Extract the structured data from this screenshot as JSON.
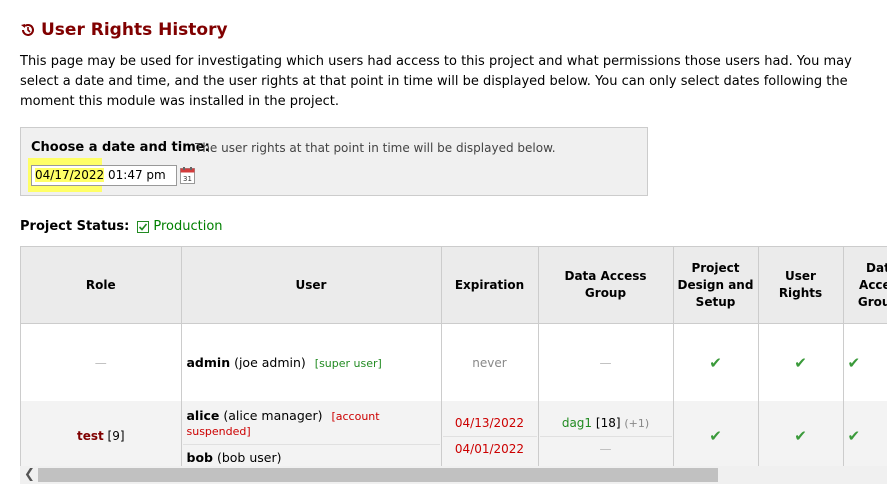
{
  "page": {
    "title": "User Rights History",
    "intro": "This page may be used for investigating which users had access to this project and what permissions those users had. You may select a date and time, and the user rights at that point in time will be displayed below. You can only select dates following the moment this module was installed in the project."
  },
  "picker": {
    "label": "Choose a date and time:",
    "hint": "The user rights at that point in time will be displayed below.",
    "date": "04/17/2022",
    "time": "01:47 pm"
  },
  "status": {
    "label": "Project Status:",
    "value": "Production"
  },
  "table": {
    "headers": {
      "role": "Role",
      "user": "User",
      "expiration": "Expiration",
      "dag": "Data Access Group",
      "design": "Project Design and Setup",
      "rights": "User Rights",
      "next": "Data Access Groups"
    },
    "row1": {
      "role": "—",
      "user_name": "admin",
      "user_full": "(joe admin)",
      "user_tag": "[super user]",
      "expiration": "never",
      "dag": "—"
    },
    "row2": {
      "role_name": "test",
      "role_count": "[9]",
      "user1_name": "alice",
      "user1_full": "(alice manager)",
      "user1_tag": "[account suspended]",
      "user1_exp": "04/13/2022",
      "user2_name": "bob",
      "user2_full": "(bob user)",
      "user2_exp": "04/01/2022",
      "dag_name": "dag1",
      "dag_count": "[18]",
      "dag_more": "(+1)",
      "dag2": "—"
    }
  },
  "colors": {
    "title": "#800000",
    "green": "#228b22",
    "red": "#cc0000",
    "highlight": "#ffff66"
  },
  "icons": [
    "history-icon",
    "calendar-icon",
    "checkbox-icon",
    "checkmark-icon",
    "scroll-left-icon"
  ]
}
